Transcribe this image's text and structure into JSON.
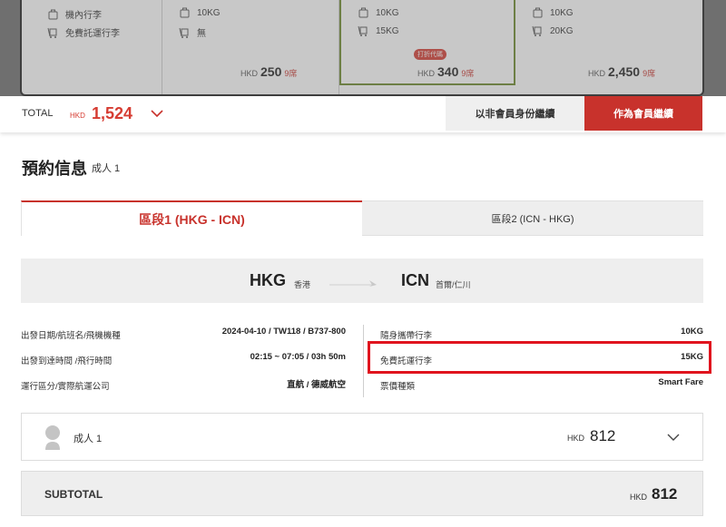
{
  "fare_cards": {
    "labels": {
      "cabin_baggage": "機內行李",
      "free_checked": "免費託運行李"
    },
    "cols": [
      {
        "cabin": "",
        "checked": "",
        "currency": "",
        "price": "",
        "seats": ""
      },
      {
        "cabin": "10KG",
        "checked": "無",
        "currency": "HKD",
        "price": "250",
        "seats": "9席"
      },
      {
        "cabin": "10KG",
        "checked": "15KG",
        "currency": "HKD",
        "price": "340",
        "seats": "9席",
        "tag": "打折代碼"
      },
      {
        "cabin": "10KG",
        "checked": "20KG",
        "currency": "HKD",
        "price": "2,450",
        "seats": "9席"
      }
    ]
  },
  "total_bar": {
    "label": "TOTAL",
    "currency": "HKD",
    "amount": "1,524",
    "guest_button": "以非會員身份繼續",
    "member_button": "作為會員繼續"
  },
  "booking": {
    "title": "預約信息",
    "subtitle": "成人 1",
    "tabs": [
      {
        "label": "區段1 (HKG - ICN)",
        "active": true
      },
      {
        "label": "區段2 (ICN - HKG)",
        "active": false
      }
    ],
    "route": {
      "from_code": "HKG",
      "from_name": "香港",
      "to_code": "ICN",
      "to_name": "首爾/仁川"
    },
    "info_left": [
      {
        "label": "出發日期/航班名/飛機機種",
        "value": "2024-04-10 / TW118 / B737-800"
      },
      {
        "label": "出發到達時間 /飛行時間",
        "value": "02:15 ~ 07:05 / 03h 50m"
      },
      {
        "label": "運行區分/實際航運公司",
        "value": "直航 / 德威航空"
      }
    ],
    "info_right": [
      {
        "label": "隨身攜帶行李",
        "value": "10KG"
      },
      {
        "label": "免費託運行李",
        "value": "15KG"
      },
      {
        "label": "票價種類",
        "value": "Smart Fare"
      }
    ],
    "passenger": {
      "label": "成人 1",
      "currency": "HKD",
      "amount": "812"
    },
    "subtotal": {
      "label": "SUBTOTAL",
      "currency": "HKD",
      "amount": "812"
    }
  },
  "colors": {
    "accent": "#c8322c",
    "highlight": "#e0141e",
    "promo": "#6d8a2c"
  }
}
